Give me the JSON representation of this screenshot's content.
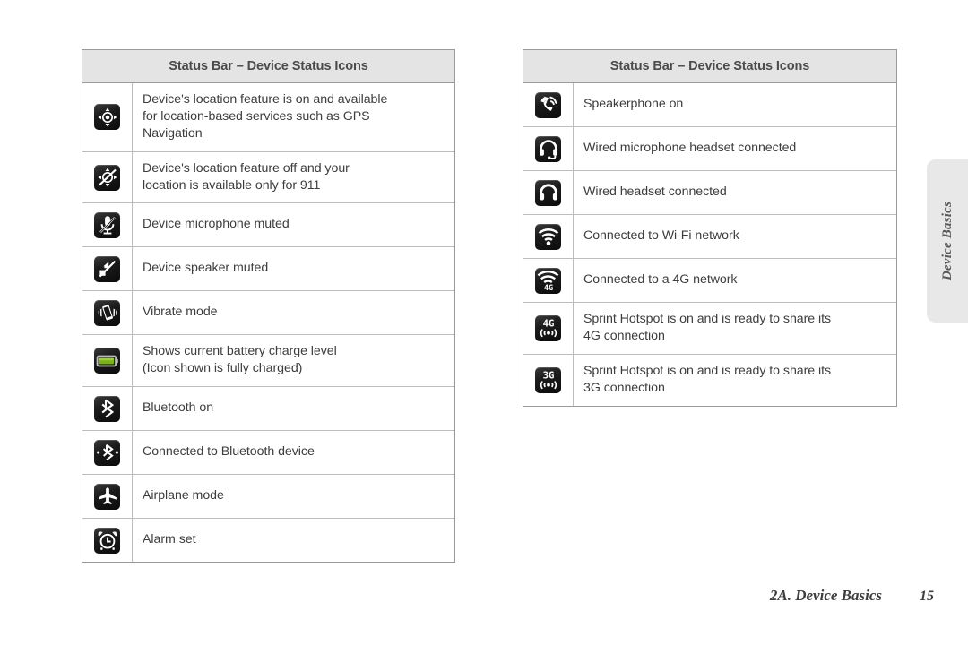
{
  "side_tab": {
    "label": "Device Basics"
  },
  "footer": {
    "chapter": "2A. Device Basics",
    "page_number": "15"
  },
  "colors": {
    "header_bg": "#e4e4e4",
    "table_border": "#9a9a9a",
    "row_border": "#bdbdbd",
    "text": "#3d3d3d",
    "battery_green": "#7ab317",
    "icon_tile": "#121212"
  },
  "left_table": {
    "header": "Status Bar – Device Status Icons",
    "rows": [
      {
        "icon": "gps-location-on-icon",
        "lines": [
          "Device's location feature is on and available",
          "for location-based services such as GPS",
          "Navigation"
        ]
      },
      {
        "icon": "gps-location-off-icon",
        "lines": [
          "Device's location feature off and your",
          "location is available only for 911"
        ]
      },
      {
        "icon": "microphone-muted-icon",
        "lines": [
          "Device microphone muted"
        ]
      },
      {
        "icon": "speaker-muted-icon",
        "lines": [
          "Device speaker muted"
        ]
      },
      {
        "icon": "vibrate-mode-icon",
        "lines": [
          "Vibrate mode"
        ]
      },
      {
        "icon": "battery-full-icon",
        "lines": [
          "Shows current battery charge level",
          "(Icon shown is fully charged)"
        ]
      },
      {
        "icon": "bluetooth-on-icon",
        "lines": [
          "Bluetooth on"
        ]
      },
      {
        "icon": "bluetooth-connected-icon",
        "lines": [
          "Connected to Bluetooth device"
        ]
      },
      {
        "icon": "airplane-mode-icon",
        "lines": [
          "Airplane mode"
        ]
      },
      {
        "icon": "alarm-clock-icon",
        "lines": [
          "Alarm set"
        ]
      }
    ]
  },
  "right_table": {
    "header": "Status Bar – Device Status Icons",
    "rows": [
      {
        "icon": "speakerphone-on-icon",
        "lines": [
          "Speakerphone on"
        ]
      },
      {
        "icon": "wired-mic-headset-icon",
        "lines": [
          "Wired microphone headset connected"
        ]
      },
      {
        "icon": "wired-headset-icon",
        "lines": [
          "Wired headset connected"
        ]
      },
      {
        "icon": "wifi-connected-icon",
        "lines": [
          "Connected to Wi-Fi network"
        ]
      },
      {
        "icon": "wifi-4g-connected-icon",
        "lines": [
          "Connected to a 4G network"
        ]
      },
      {
        "icon": "hotspot-4g-icon",
        "lines": [
          "Sprint Hotspot is on and is ready to share its",
          "4G connection"
        ]
      },
      {
        "icon": "hotspot-3g-icon",
        "lines": [
          "Sprint Hotspot is on and is ready to share its",
          "3G connection"
        ]
      }
    ]
  }
}
